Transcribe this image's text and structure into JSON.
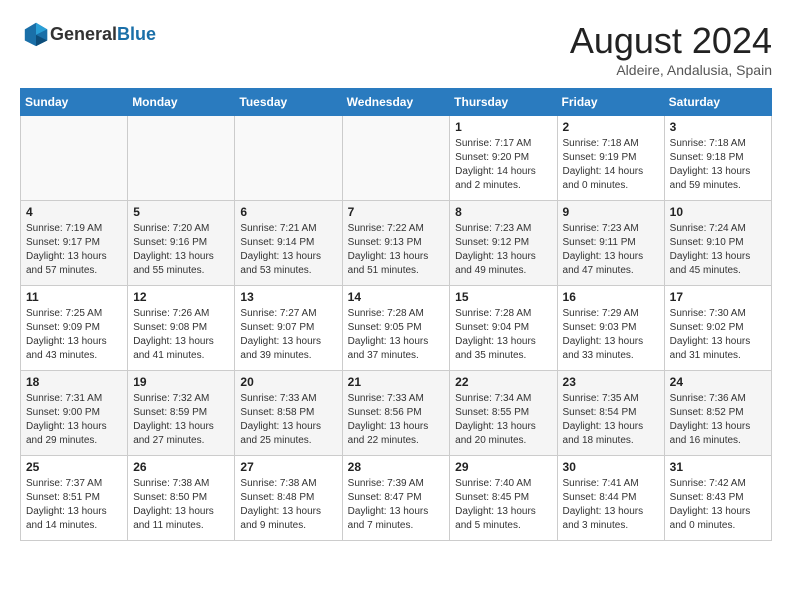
{
  "header": {
    "logo_general": "General",
    "logo_blue": "Blue",
    "month_year": "August 2024",
    "location": "Aldeire, Andalusia, Spain"
  },
  "weekdays": [
    "Sunday",
    "Monday",
    "Tuesday",
    "Wednesday",
    "Thursday",
    "Friday",
    "Saturday"
  ],
  "weeks": [
    [
      {
        "day": "",
        "info": ""
      },
      {
        "day": "",
        "info": ""
      },
      {
        "day": "",
        "info": ""
      },
      {
        "day": "",
        "info": ""
      },
      {
        "day": "1",
        "info": "Sunrise: 7:17 AM\nSunset: 9:20 PM\nDaylight: 14 hours\nand 2 minutes."
      },
      {
        "day": "2",
        "info": "Sunrise: 7:18 AM\nSunset: 9:19 PM\nDaylight: 14 hours\nand 0 minutes."
      },
      {
        "day": "3",
        "info": "Sunrise: 7:18 AM\nSunset: 9:18 PM\nDaylight: 13 hours\nand 59 minutes."
      }
    ],
    [
      {
        "day": "4",
        "info": "Sunrise: 7:19 AM\nSunset: 9:17 PM\nDaylight: 13 hours\nand 57 minutes."
      },
      {
        "day": "5",
        "info": "Sunrise: 7:20 AM\nSunset: 9:16 PM\nDaylight: 13 hours\nand 55 minutes."
      },
      {
        "day": "6",
        "info": "Sunrise: 7:21 AM\nSunset: 9:14 PM\nDaylight: 13 hours\nand 53 minutes."
      },
      {
        "day": "7",
        "info": "Sunrise: 7:22 AM\nSunset: 9:13 PM\nDaylight: 13 hours\nand 51 minutes."
      },
      {
        "day": "8",
        "info": "Sunrise: 7:23 AM\nSunset: 9:12 PM\nDaylight: 13 hours\nand 49 minutes."
      },
      {
        "day": "9",
        "info": "Sunrise: 7:23 AM\nSunset: 9:11 PM\nDaylight: 13 hours\nand 47 minutes."
      },
      {
        "day": "10",
        "info": "Sunrise: 7:24 AM\nSunset: 9:10 PM\nDaylight: 13 hours\nand 45 minutes."
      }
    ],
    [
      {
        "day": "11",
        "info": "Sunrise: 7:25 AM\nSunset: 9:09 PM\nDaylight: 13 hours\nand 43 minutes."
      },
      {
        "day": "12",
        "info": "Sunrise: 7:26 AM\nSunset: 9:08 PM\nDaylight: 13 hours\nand 41 minutes."
      },
      {
        "day": "13",
        "info": "Sunrise: 7:27 AM\nSunset: 9:07 PM\nDaylight: 13 hours\nand 39 minutes."
      },
      {
        "day": "14",
        "info": "Sunrise: 7:28 AM\nSunset: 9:05 PM\nDaylight: 13 hours\nand 37 minutes."
      },
      {
        "day": "15",
        "info": "Sunrise: 7:28 AM\nSunset: 9:04 PM\nDaylight: 13 hours\nand 35 minutes."
      },
      {
        "day": "16",
        "info": "Sunrise: 7:29 AM\nSunset: 9:03 PM\nDaylight: 13 hours\nand 33 minutes."
      },
      {
        "day": "17",
        "info": "Sunrise: 7:30 AM\nSunset: 9:02 PM\nDaylight: 13 hours\nand 31 minutes."
      }
    ],
    [
      {
        "day": "18",
        "info": "Sunrise: 7:31 AM\nSunset: 9:00 PM\nDaylight: 13 hours\nand 29 minutes."
      },
      {
        "day": "19",
        "info": "Sunrise: 7:32 AM\nSunset: 8:59 PM\nDaylight: 13 hours\nand 27 minutes."
      },
      {
        "day": "20",
        "info": "Sunrise: 7:33 AM\nSunset: 8:58 PM\nDaylight: 13 hours\nand 25 minutes."
      },
      {
        "day": "21",
        "info": "Sunrise: 7:33 AM\nSunset: 8:56 PM\nDaylight: 13 hours\nand 22 minutes."
      },
      {
        "day": "22",
        "info": "Sunrise: 7:34 AM\nSunset: 8:55 PM\nDaylight: 13 hours\nand 20 minutes."
      },
      {
        "day": "23",
        "info": "Sunrise: 7:35 AM\nSunset: 8:54 PM\nDaylight: 13 hours\nand 18 minutes."
      },
      {
        "day": "24",
        "info": "Sunrise: 7:36 AM\nSunset: 8:52 PM\nDaylight: 13 hours\nand 16 minutes."
      }
    ],
    [
      {
        "day": "25",
        "info": "Sunrise: 7:37 AM\nSunset: 8:51 PM\nDaylight: 13 hours\nand 14 minutes."
      },
      {
        "day": "26",
        "info": "Sunrise: 7:38 AM\nSunset: 8:50 PM\nDaylight: 13 hours\nand 11 minutes."
      },
      {
        "day": "27",
        "info": "Sunrise: 7:38 AM\nSunset: 8:48 PM\nDaylight: 13 hours\nand 9 minutes."
      },
      {
        "day": "28",
        "info": "Sunrise: 7:39 AM\nSunset: 8:47 PM\nDaylight: 13 hours\nand 7 minutes."
      },
      {
        "day": "29",
        "info": "Sunrise: 7:40 AM\nSunset: 8:45 PM\nDaylight: 13 hours\nand 5 minutes."
      },
      {
        "day": "30",
        "info": "Sunrise: 7:41 AM\nSunset: 8:44 PM\nDaylight: 13 hours\nand 3 minutes."
      },
      {
        "day": "31",
        "info": "Sunrise: 7:42 AM\nSunset: 8:43 PM\nDaylight: 13 hours\nand 0 minutes."
      }
    ]
  ]
}
